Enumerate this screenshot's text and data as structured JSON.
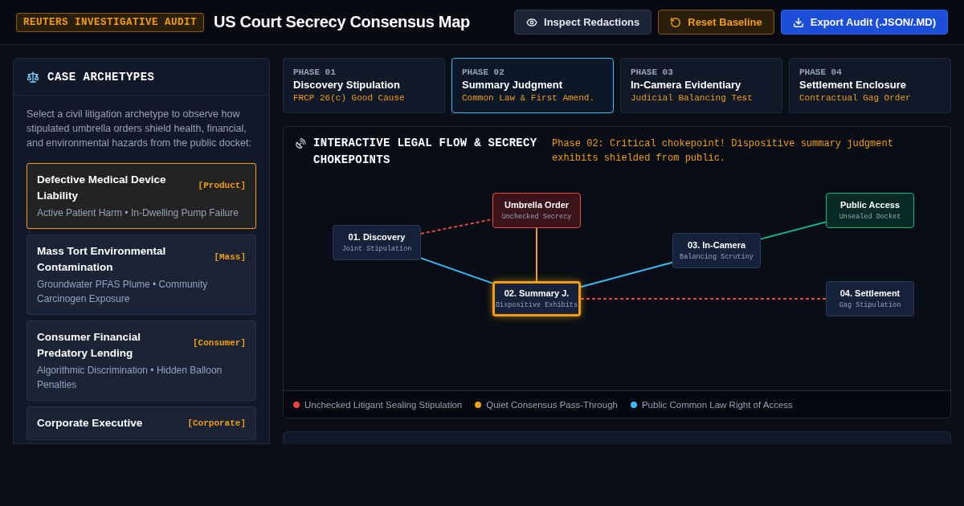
{
  "header": {
    "badge": "REUTERS INVESTIGATIVE AUDIT",
    "title": "US Court Secrecy Consensus Map",
    "buttons": [
      {
        "kind": "inspect",
        "label": "Inspect Redactions"
      },
      {
        "kind": "reset",
        "label": "Reset Baseline"
      },
      {
        "kind": "export",
        "label": "Export Audit (.JSON/.MD)"
      }
    ]
  },
  "sidebar": {
    "title": "CASE ARCHETYPES",
    "intro": "Select a civil litigation archetype to observe how stipulated umbrella orders shield health, financial, and environmental hazards from the public docket:",
    "items": [
      {
        "title": "Defective Medical Device Liability",
        "tag": "[Product]",
        "detail": "Active Patient Harm • In-Dwelling Pump Failure",
        "selected": true
      },
      {
        "title": "Mass Tort Environmental Contamination",
        "tag": "[Mass]",
        "detail": "Groundwater PFAS Plume • Community Carcinogen Exposure",
        "selected": false
      },
      {
        "title": "Consumer Financial Predatory Lending",
        "tag": "[Consumer]",
        "detail": "Algorithmic Discrimination • Hidden Balloon Penalties",
        "selected": false
      },
      {
        "title": "Corporate Executive",
        "tag": "[Corporate]",
        "selected": false
      }
    ]
  },
  "phases": [
    {
      "label": "PHASE 01",
      "title": "Discovery Stipulation",
      "rule": "FRCP 26(c) Good Cause",
      "selected": false
    },
    {
      "label": "PHASE 02",
      "title": "Summary Judgment",
      "rule": "Common Law & First Amend.",
      "selected": true
    },
    {
      "label": "PHASE 03",
      "title": "In-Camera Evidentiary",
      "rule": "Judicial Balancing Test",
      "selected": false
    },
    {
      "label": "PHASE 04",
      "title": "Settlement Enclosure",
      "rule": "Contractual Gag Order",
      "selected": false
    }
  ],
  "flow": {
    "title": "INTERACTIVE LEGAL FLOW & SECRECY CHOKEPOINTS",
    "status": "Phase 02: Critical chokepoint! Dispositive summary judgment exhibits shielded from public.",
    "nodes": [
      {
        "kind": "neutral",
        "title": "01. Discovery",
        "subtitle": "Joint Stipulation"
      },
      {
        "kind": "secrecy",
        "title": "Umbrella Order",
        "subtitle": "Unchecked Secrecy"
      },
      {
        "kind": "active",
        "title": "02. Summary J.",
        "subtitle": "Dispositive Exhibits"
      },
      {
        "kind": "neutral",
        "title": "03. In-Camera",
        "subtitle": "Balancing Scrutiny"
      },
      {
        "kind": "public",
        "title": "Public Access",
        "subtitle": "Unsealed Docket"
      },
      {
        "kind": "neutral",
        "title": "04. Settlement",
        "subtitle": "Gag Stipulation"
      }
    ],
    "edges": [
      {
        "kind": "sealing"
      },
      {
        "kind": "access"
      },
      {
        "kind": "passthrough"
      },
      {
        "kind": "access"
      },
      {
        "kind": "public"
      },
      {
        "kind": "sealing"
      }
    ],
    "legend": [
      {
        "label": "Unchecked Litigant Sealing Stipulation",
        "color": "#ef4444"
      },
      {
        "label": "Quiet Consensus Pass-Through",
        "color": "#f59e0b"
      },
      {
        "label": "Public Common Law Right of Access",
        "color": "#38bdf8"
      }
    ]
  }
}
